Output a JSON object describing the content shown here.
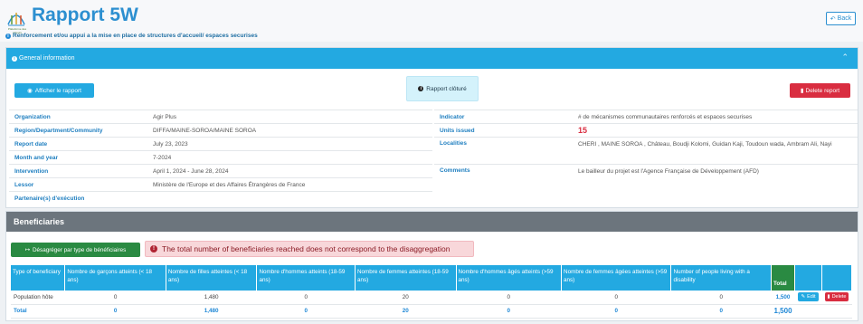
{
  "header": {
    "title": "Rapport 5W",
    "logo_text": "Plateforme des acteurs",
    "back_label": "Back",
    "subtitle": "Renforcement et/ou appui a la mise en place de structures d'accueil/ espaces securises"
  },
  "general": {
    "title": "General information",
    "show_report_label": "Afficher le rapport",
    "closed_label": "Rapport clôturé",
    "delete_label": "Delete report",
    "left_fields": [
      {
        "label": "Organization",
        "value": "Agir Plus"
      },
      {
        "label": "Region/Department/Community",
        "value": "DIFFA/MAINE-SOROA/MAINE SOROA"
      },
      {
        "label": "Report date",
        "value": "July 23, 2023"
      },
      {
        "label": "Month and year",
        "value": "7-2024"
      },
      {
        "label": "Intervention",
        "value": "April 1, 2024 - June 28, 2024"
      },
      {
        "label": "Lessor",
        "value": "Ministère de l'Europe et des Affaires Étrangères de France"
      },
      {
        "label": "Partenaire(s) d'exécution",
        "value": ""
      }
    ],
    "right_fields": [
      {
        "label": "Indicator",
        "value": "# de mécanismes communautaires renforcés et espaces securises"
      },
      {
        "label": "Units issued",
        "value": "15"
      },
      {
        "label": "Localities",
        "value": "CHERI , MAINE SOROA , Château, Boudji Kolomi, Guidan Kaji, Toudoun wada, Ambram Ali, Nayi"
      },
      {
        "label": "Comments",
        "value": "Le bailleur du projet est l'Agence Française de Développement (AFD)"
      }
    ]
  },
  "beneficiaries": {
    "title": "Beneficiaries",
    "disagg_label": "Désagréger par type de bénéficiaires",
    "alert": "The total number of beneficiaries reached does not correspond to the disaggregation",
    "columns": [
      "Type of beneficiary",
      "Nombre de garçons atteints (< 18 ans)",
      "Nombre de filles atteintes (< 18 ans)",
      "Nombre d'hommes atteints (18-59 ans)",
      "Nombre de femmes atteintes (18-59 ans)",
      "Nombre d'hommes âgés atteints (>59 ans)",
      "Nombre de femmes âgées atteintes (>59 ans)",
      "Number of people living with a disability",
      "Total"
    ],
    "rows": [
      {
        "type": "Population hôte",
        "values": [
          "0",
          "1,480",
          "0",
          "20",
          "0",
          "0",
          "0"
        ],
        "total": "1,500",
        "edit": "Edit",
        "delete": "Delete"
      }
    ],
    "total_row": {
      "label": "Total",
      "values": [
        "0",
        "1,480",
        "0",
        "20",
        "0",
        "0",
        "0"
      ],
      "total": "1,500"
    }
  }
}
